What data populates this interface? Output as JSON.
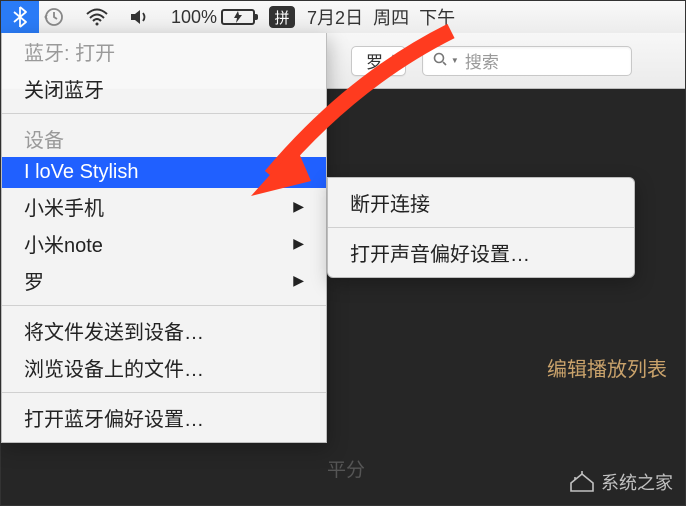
{
  "menubar": {
    "battery_percent": "100%",
    "ime_label": "拼",
    "date": "7月2日",
    "weekday": "周四",
    "time_prefix": "下午"
  },
  "toolbar": {
    "dropdown_label": "罗",
    "search_placeholder": "搜索"
  },
  "bluetooth_menu": {
    "status_label": "蓝牙: 打开",
    "turn_off": "关闭蓝牙",
    "devices_header": "设备",
    "devices": [
      {
        "name": "I loVe Stylish",
        "selected": true,
        "has_submenu": true
      },
      {
        "name": "小米手机",
        "selected": false,
        "has_submenu": true
      },
      {
        "name": "小米note",
        "selected": false,
        "has_submenu": true
      },
      {
        "name": "罗",
        "selected": false,
        "has_submenu": true
      }
    ],
    "send_file": "将文件发送到设备…",
    "browse_files": "浏览设备上的文件…",
    "open_prefs": "打开蓝牙偏好设置…"
  },
  "submenu": {
    "disconnect": "断开连接",
    "open_sound_pref": "打开声音偏好设置…"
  },
  "content": {
    "edit_playlist": "编辑播放列表",
    "leftover": "平分"
  },
  "watermark": "系统之家"
}
